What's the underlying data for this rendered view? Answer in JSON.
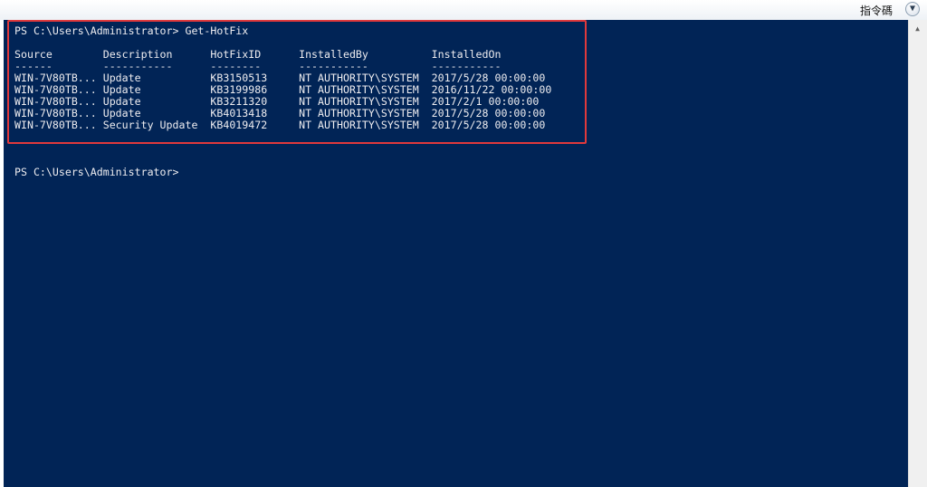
{
  "toolbar": {
    "label": "指令碼",
    "expand_icon": "chevron-down-icon"
  },
  "console": {
    "command_line": "PS C:\\Users\\Administrator> Get-HotFix",
    "header_line": "Source        Description      HotFixID      InstalledBy          InstalledOn",
    "separator_line": "------        -----------      --------      -----------          -----------",
    "rows": [
      "WIN-7V80TB... Update           KB3150513     NT AUTHORITY\\SYSTEM  2017/5/28 00:00:00",
      "WIN-7V80TB... Update           KB3199986     NT AUTHORITY\\SYSTEM  2016/11/22 00:00:00",
      "WIN-7V80TB... Update           KB3211320     NT AUTHORITY\\SYSTEM  2017/2/1 00:00:00",
      "WIN-7V80TB... Update           KB4013418     NT AUTHORITY\\SYSTEM  2017/5/28 00:00:00",
      "WIN-7V80TB... Security Update  KB4019472     NT AUTHORITY\\SYSTEM  2017/5/28 00:00:00"
    ],
    "prompt_line": "PS C:\\Users\\Administrator>",
    "highlight_color": "#e0393c",
    "background_color": "#012456"
  }
}
